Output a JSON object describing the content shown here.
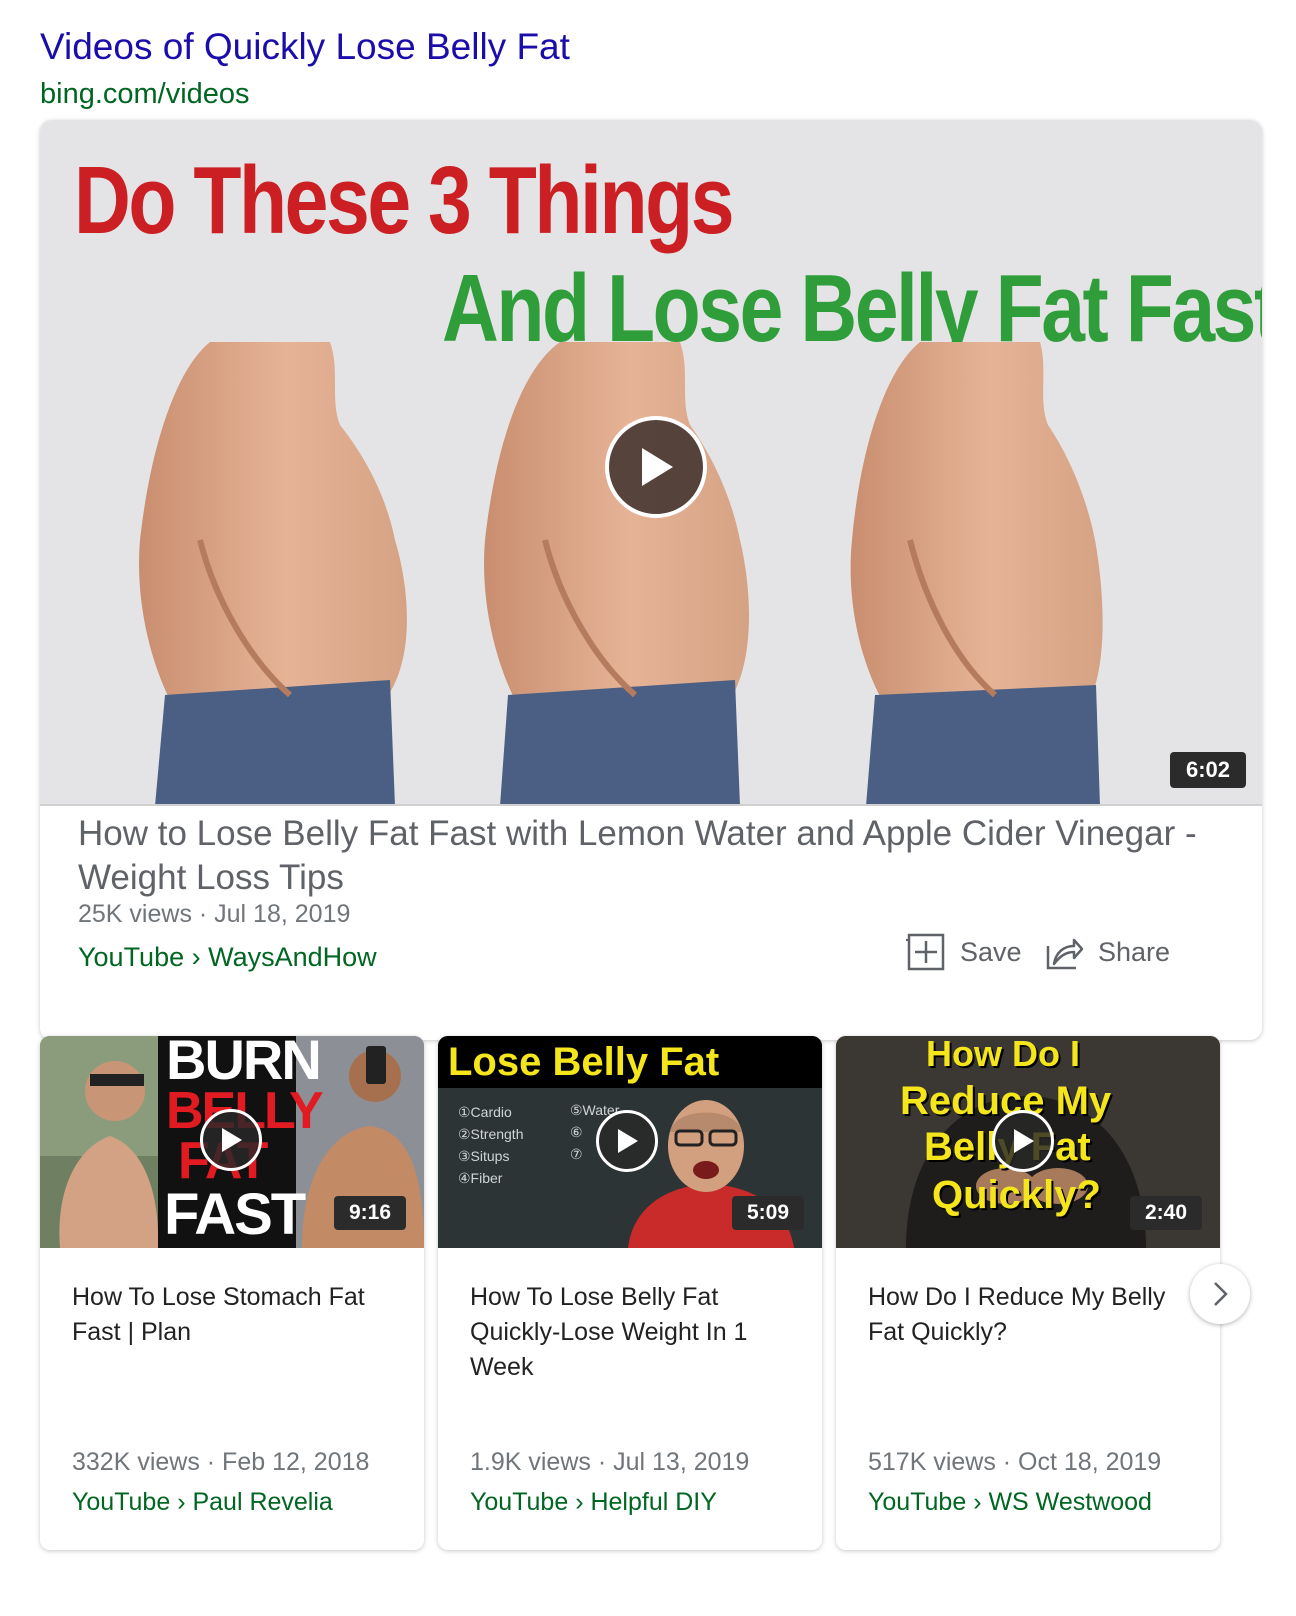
{
  "header": {
    "title": "Videos of Quickly Lose Belly Fat",
    "source": "bing.com/videos"
  },
  "featured": {
    "thumbnail_line1": "Do These 3 Things",
    "thumbnail_line2": "And Lose Belly Fat Fast",
    "duration": "6:02",
    "title": "How to Lose Belly Fat Fast with Lemon Water and Apple Cider Vinegar - Weight Loss Tips",
    "meta": "25K views · Jul 18, 2019",
    "source": "YouTube › WaysAndHow",
    "save_label": "Save",
    "share_label": "Share"
  },
  "cards": [
    {
      "thumb_words": [
        "BURN",
        "BELLY",
        "FAT",
        "FAST"
      ],
      "duration": "9:16",
      "title": "How To Lose Stomach Fat Fast | Plan",
      "meta": "332K views · Feb 12, 2018",
      "source": "YouTube › Paul Revelia"
    },
    {
      "thumb_headline": "Lose Belly Fat",
      "thumb_board": [
        "①Cardio",
        "②Strength",
        "③Situps",
        "④Fiber",
        "⑤Water",
        "⑥",
        "⑦"
      ],
      "duration": "5:09",
      "title": "How To Lose Belly Fat Quickly-Lose Weight In 1 Week",
      "meta": "1.9K views · Jul 13, 2019",
      "source": "YouTube › Helpful DIY"
    },
    {
      "thumb_lines": [
        "How Do I",
        "Reduce My",
        "Belly Fat",
        "Quickly?"
      ],
      "duration": "2:40",
      "title": "How Do I Reduce My Belly Fat Quickly?",
      "meta": "517K views · Oct 18, 2019",
      "source": "YouTube › WS Westwood"
    }
  ],
  "icons": {
    "play": "play-icon",
    "save": "add-box-icon",
    "share": "share-arrow-icon",
    "next": "chevron-right-icon"
  },
  "colors": {
    "link": "#1a0dab",
    "source_green": "#006621",
    "thumb_red": "#cc1f24",
    "thumb_green": "#2f9e3a",
    "yellow_text": "#f4e61b"
  }
}
